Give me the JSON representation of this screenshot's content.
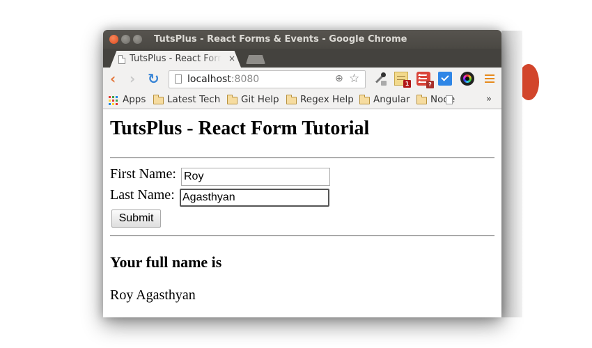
{
  "window": {
    "title": "TutsPlus - React Forms & Events - Google Chrome",
    "controls": {
      "close": "x",
      "minimize": "–",
      "maximize": "□"
    }
  },
  "tab": {
    "title": "TutsPlus - React Form",
    "close": "×"
  },
  "toolbar": {
    "back": "‹",
    "forward": "›",
    "reload": "↻",
    "url_host": "localhost",
    "url_port": ":8080",
    "zoom_icon": "⊕",
    "star_icon": "☆",
    "extensions": [
      {
        "name": "color-picker",
        "badge": ""
      },
      {
        "name": "sticky-notes",
        "badge": "1"
      },
      {
        "name": "todoist",
        "badge": "?"
      },
      {
        "name": "checkmark",
        "badge": ""
      },
      {
        "name": "camera",
        "badge": ""
      }
    ]
  },
  "bookmarks": {
    "apps_label": "Apps",
    "items": [
      "Latest Tech",
      "Git Help",
      "Regex Help",
      "Angular",
      "Node"
    ],
    "more": "»"
  },
  "page": {
    "heading": "TutsPlus - React Form Tutorial",
    "first_name_label": "First Name:",
    "first_name_value": "Roy",
    "last_name_label": "Last Name:",
    "last_name_value": "Agasthyan",
    "submit_label": "Submit",
    "result_heading": "Your full name is",
    "result_value": "Roy Agasthyan"
  },
  "colors": {
    "titlebar": "#4f4d48",
    "toolbar": "#f2f1f0",
    "close_button": "#e95420",
    "back_arrow": "#e4773b",
    "reload": "#3b86d6",
    "menu": "#e68a1c"
  }
}
